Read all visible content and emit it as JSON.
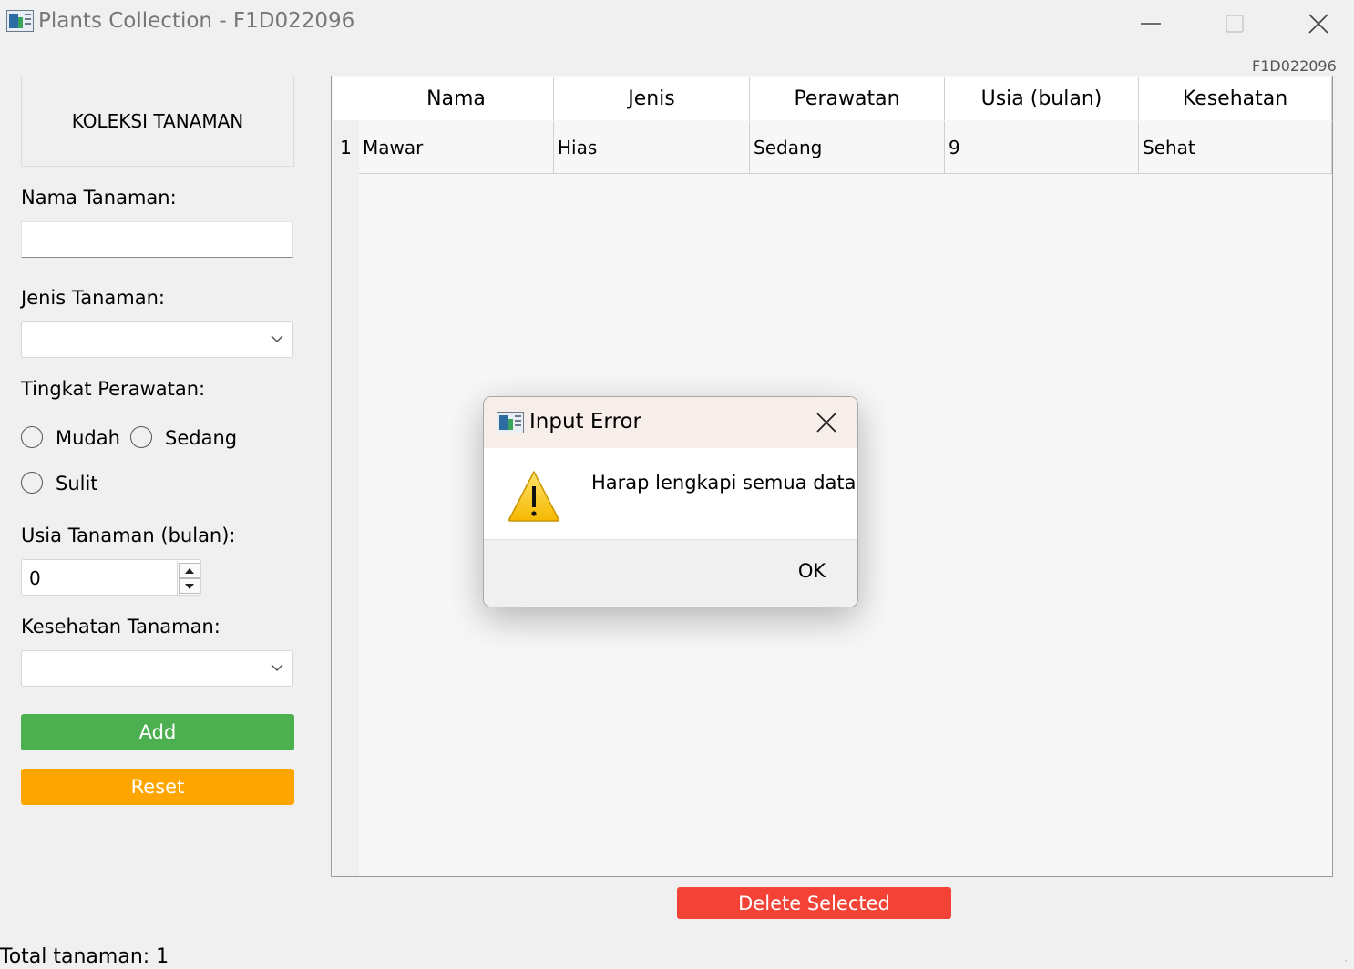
{
  "window": {
    "title": "Plants Collection - F1D022096",
    "id_label": "F1D022096"
  },
  "form": {
    "header": "KOLEKSI TANAMAN",
    "nama_label": "Nama Tanaman:",
    "nama_value": "",
    "jenis_label": "Jenis Tanaman:",
    "jenis_value": "",
    "perawatan_label": "Tingkat Perawatan:",
    "perawatan_options": [
      "Mudah",
      "Sedang",
      "Sulit"
    ],
    "usia_label": "Usia Tanaman (bulan):",
    "usia_value": "0",
    "kesehatan_label": "Kesehatan Tanaman:",
    "kesehatan_value": "",
    "add_label": "Add",
    "reset_label": "Reset"
  },
  "table": {
    "columns": [
      "Nama",
      "Jenis",
      "Perawatan",
      "Usia (bulan)",
      "Kesehatan"
    ],
    "rows": [
      {
        "num": "1",
        "cells": [
          "Mawar",
          "Hias",
          "Sedang",
          "9",
          "Sehat"
        ]
      }
    ]
  },
  "delete_label": "Delete Selected",
  "total_label": "Total tanaman: 1",
  "dialog": {
    "title": "Input Error",
    "message": "Harap lengkapi semua data.",
    "ok_label": "OK"
  },
  "colors": {
    "add": "#4caf50",
    "reset": "#ffa500",
    "delete": "#f44336"
  }
}
